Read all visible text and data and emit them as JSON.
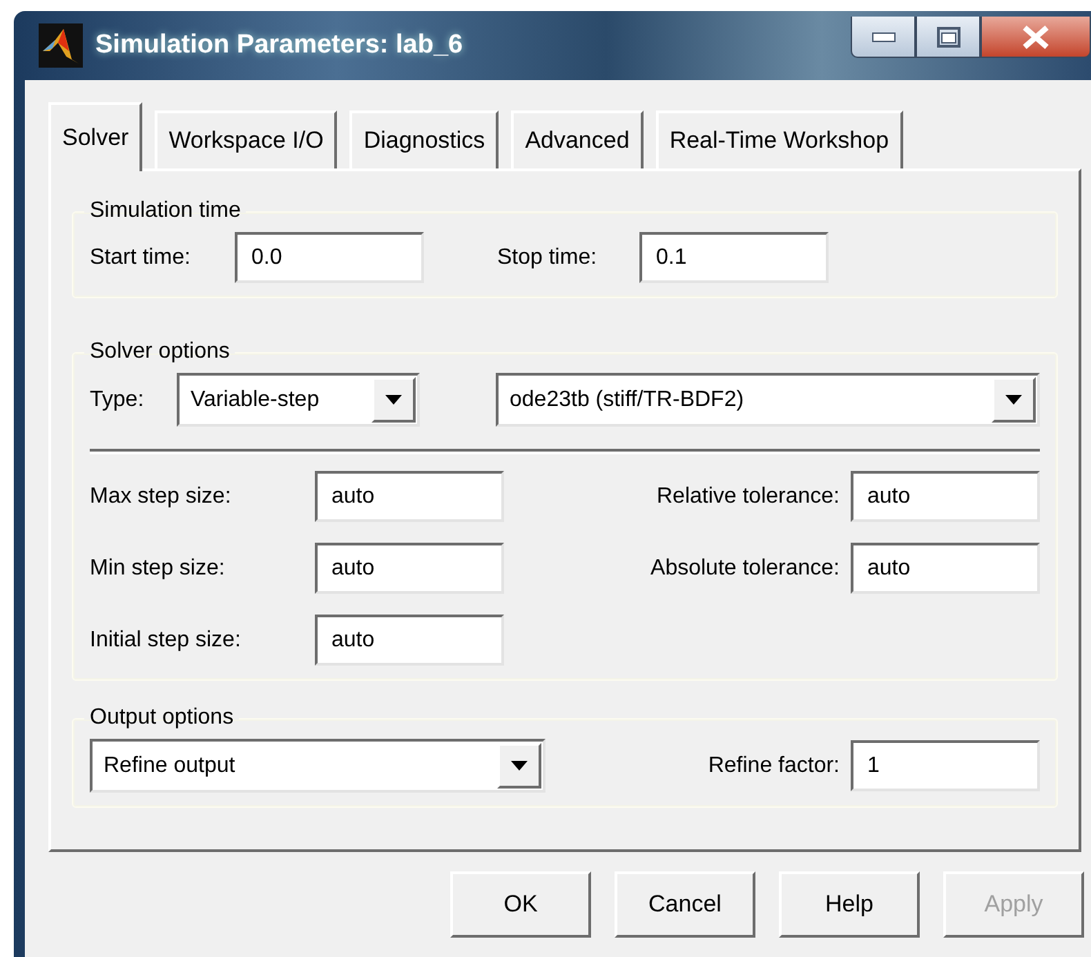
{
  "window": {
    "title": "Simulation Parameters: lab_6"
  },
  "tabs": [
    {
      "label": "Solver",
      "selected": true
    },
    {
      "label": "Workspace I/O",
      "selected": false
    },
    {
      "label": "Diagnostics",
      "selected": false
    },
    {
      "label": "Advanced",
      "selected": false
    },
    {
      "label": "Real-Time Workshop",
      "selected": false
    }
  ],
  "simulation_time": {
    "title": "Simulation time",
    "start_time": {
      "label": "Start time:",
      "value": "0.0"
    },
    "stop_time": {
      "label": "Stop time:",
      "value": "0.1"
    }
  },
  "solver_options": {
    "title": "Solver options",
    "type_label": "Type:",
    "type": "Variable-step",
    "solver": "ode23tb (stiff/TR-BDF2)",
    "fields": [
      {
        "label": "Max step size:",
        "value": "auto"
      },
      {
        "label": "Relative tolerance:",
        "value": "auto"
      },
      {
        "label": "Min step size:",
        "value": "auto"
      },
      {
        "label": "Absolute tolerance:",
        "value": "auto"
      },
      {
        "label": "Initial step size:",
        "value": "auto"
      }
    ]
  },
  "output_options": {
    "title": "Output options",
    "mode": "Refine output",
    "refine_factor": {
      "label": "Refine factor:",
      "value": "1"
    }
  },
  "buttons": [
    {
      "label": "OK",
      "disabled": false
    },
    {
      "label": "Cancel",
      "disabled": false
    },
    {
      "label": "Help",
      "disabled": false
    },
    {
      "label": "Apply",
      "disabled": true
    }
  ]
}
